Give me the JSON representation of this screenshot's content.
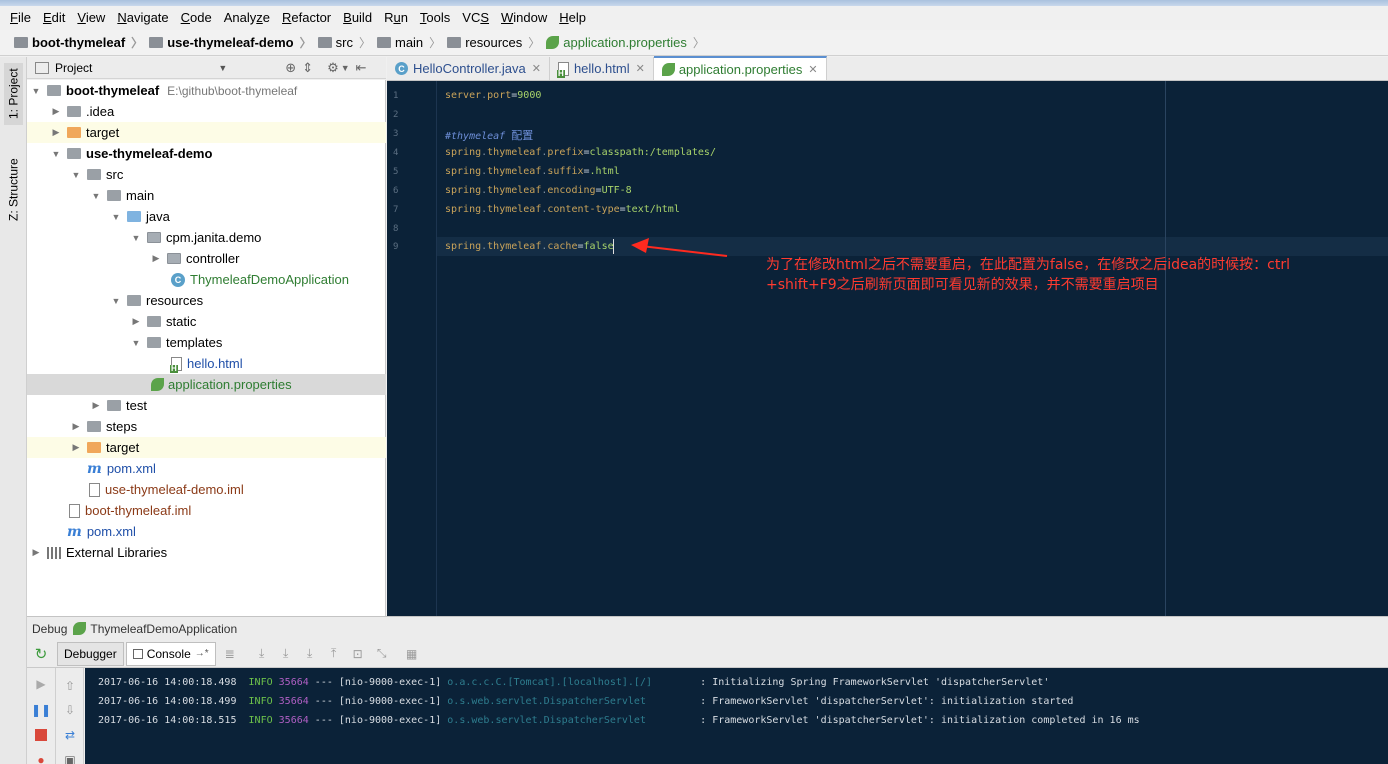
{
  "menu": [
    "File",
    "Edit",
    "View",
    "Navigate",
    "Code",
    "Analyze",
    "Refactor",
    "Build",
    "Run",
    "Tools",
    "VCS",
    "Window",
    "Help"
  ],
  "menu_mnemonics": [
    "F",
    "E",
    "V",
    "N",
    "C",
    "z",
    "R",
    "B",
    "u",
    "T",
    "S",
    "W",
    "H"
  ],
  "breadcrumb": [
    "boot-thymeleaf",
    "use-thymeleaf-demo",
    "src",
    "main",
    "resources",
    "application.properties"
  ],
  "side_tabs": {
    "project": "1: Project",
    "structure": "Z: Structure"
  },
  "project_panel": {
    "title": "Project"
  },
  "tree": [
    {
      "label": "boot-thymeleaf",
      "hint": "E:\\github\\boot-thymeleaf"
    },
    {
      "label": ".idea"
    },
    {
      "label": "target"
    },
    {
      "label": "use-thymeleaf-demo"
    },
    {
      "label": "src"
    },
    {
      "label": "main"
    },
    {
      "label": "java"
    },
    {
      "label": "cpm.janita.demo"
    },
    {
      "label": "controller"
    },
    {
      "label": "ThymeleafDemoApplication"
    },
    {
      "label": "resources"
    },
    {
      "label": "static"
    },
    {
      "label": "templates"
    },
    {
      "label": "hello.html"
    },
    {
      "label": "application.properties"
    },
    {
      "label": "test"
    },
    {
      "label": "steps"
    },
    {
      "label": "target"
    },
    {
      "label": "pom.xml"
    },
    {
      "label": "use-thymeleaf-demo.iml"
    },
    {
      "label": "boot-thymeleaf.iml"
    },
    {
      "label": "pom.xml"
    },
    {
      "label": "External Libraries"
    }
  ],
  "editor_tabs": [
    "HelloController.java",
    "hello.html",
    "application.properties"
  ],
  "editor": {
    "line_numbers": [
      "1",
      "2",
      "3",
      "4",
      "5",
      "6",
      "7",
      "8",
      "9"
    ],
    "lines": [
      {
        "key": [
          "server",
          "port"
        ],
        "value": "9000"
      },
      {},
      {
        "comment": "#thymeleaf",
        "comment_cn": "配置"
      },
      {
        "key": [
          "spring",
          "thymeleaf",
          "prefix"
        ],
        "value": "classpath:/templates/"
      },
      {
        "key": [
          "spring",
          "thymeleaf",
          "suffix"
        ],
        "value": ".html"
      },
      {
        "key": [
          "spring",
          "thymeleaf",
          "encoding"
        ],
        "value": "UTF-8"
      },
      {
        "key": [
          "spring",
          "thymeleaf",
          "content-type"
        ],
        "value": "text/html"
      },
      {},
      {
        "key": [
          "spring",
          "thymeleaf",
          "cache"
        ],
        "value": "false"
      }
    ]
  },
  "annotation": {
    "line1": "为了在修改html之后不需要重启，在此配置为false，在修改之后idea的时候按：ctrl",
    "line2": "+shift+F9之后刷新页面即可看见新的效果，并不需要重启项目",
    "color": "#ff3b30"
  },
  "debug": {
    "label": "Debug",
    "config": "ThymeleafDemoApplication",
    "tabs": [
      "Debugger",
      "Console"
    ]
  },
  "console": [
    {
      "time": "2017-06-16 14:00:18.498",
      "level": "INFO",
      "pid": "35664",
      "sep": "---",
      "thread": "[nio-9000-exec-1]",
      "logger": "o.a.c.c.C.[Tomcat].[localhost].[/]",
      "message": ": Initializing Spring FrameworkServlet 'dispatcherServlet'"
    },
    {
      "time": "2017-06-16 14:00:18.499",
      "level": "INFO",
      "pid": "35664",
      "sep": "---",
      "thread": "[nio-9000-exec-1]",
      "logger": "o.s.web.servlet.DispatcherServlet",
      "message": ": FrameworkServlet 'dispatcherServlet': initialization started"
    },
    {
      "time": "2017-06-16 14:00:18.515",
      "level": "INFO",
      "pid": "35664",
      "sep": "---",
      "thread": "[nio-9000-exec-1]",
      "logger": "o.s.web.servlet.DispatcherServlet",
      "message": ": FrameworkServlet 'dispatcherServlet': initialization completed in 16 ms"
    }
  ],
  "colors": {
    "editor_bg": "#0b2238",
    "key": "#c9a35a",
    "value": "#a8d36a",
    "comment": "#6e8fd8",
    "log_info": "#6cc04a",
    "log_pid": "#b05fc4"
  }
}
